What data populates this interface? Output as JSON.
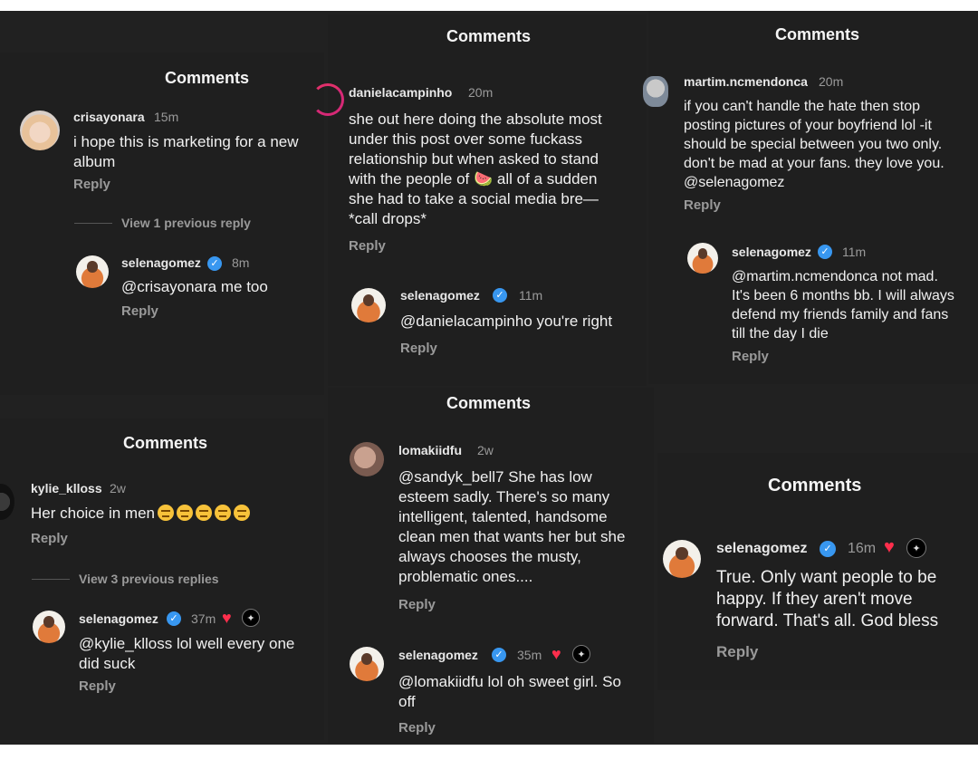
{
  "panels": {
    "p1": {
      "title": "Comments",
      "comment": {
        "user": "crisayonara",
        "time": "15m",
        "text": "i hope this is marketing for a new album",
        "reply": "Reply"
      },
      "view_prev": "View 1 previous reply",
      "reply": {
        "user": "selenagomez",
        "time": "8m",
        "text": "@crisayonara me too",
        "reply": "Reply"
      }
    },
    "p2": {
      "title": "Comments",
      "comment": {
        "user": "danielacampinho",
        "time": "20m",
        "line1": "she out here doing the absolute most",
        "line2": "under this post over some fuckass",
        "line3": "relationship but when asked to stand",
        "line4a": "with the people of ",
        "watermelon": "🍉",
        "line4b": " all of a sudden",
        "line5": "she had to take a social media bre—",
        "line6": "*call drops*",
        "reply": "Reply"
      },
      "reply": {
        "user": "selenagomez",
        "time": "11m",
        "text": "@danielacampinho you're right",
        "reply": "Reply"
      }
    },
    "p3": {
      "title": "Comments",
      "comment": {
        "user": "martim.ncmendonca",
        "time": "20m",
        "text": "if you can't handle the hate then stop posting pictures of your boyfriend lol -it should be special between you two only. don't be mad at your fans. they love you. @selenagomez",
        "reply": "Reply"
      },
      "reply": {
        "user": "selenagomez",
        "time": "11m",
        "text": "@martim.ncmendonca not mad. It's been 6 months bb. I will always defend my friends family and fans till the day I die",
        "reply": "Reply"
      }
    },
    "p4": {
      "title": "Comments",
      "comment": {
        "user": "kylie_klloss",
        "time": "2w",
        "text": "Her choice in men",
        "reply": "Reply"
      },
      "view_prev": "View 3 previous replies",
      "reply": {
        "user": "selenagomez",
        "time": "37m",
        "text": "@kylie_klloss lol well every one did suck",
        "reply": "Reply"
      }
    },
    "p5": {
      "title": "Comments",
      "comment": {
        "user": "lomakiidfu",
        "time": "2w",
        "text": "@sandyk_bell7 She has low esteem sadly. There's so many intelligent, talented, handsome clean men that wants her but she always chooses the musty, problematic ones....",
        "reply": "Reply"
      },
      "reply": {
        "user": "selenagomez",
        "time": "35m",
        "text": "@lomakiidfu lol oh sweet girl. So off",
        "reply": "Reply"
      }
    },
    "p6": {
      "title": "Comments",
      "reply": {
        "user": "selenagomez",
        "time": "16m",
        "text": "True. Only want people to be happy. If they aren't move forward. That's all. God bless",
        "reply": "Reply"
      }
    }
  },
  "icons": {
    "verified": "verified-badge-icon",
    "heart": "heart-icon",
    "pinned": "creator-pin-icon",
    "emoji": "expressionless-face-emoji"
  },
  "colors": {
    "background": "#1f1f1f",
    "verified": "#3897f0",
    "heart": "#ff2e4c",
    "muted": "#9a9a9a"
  }
}
